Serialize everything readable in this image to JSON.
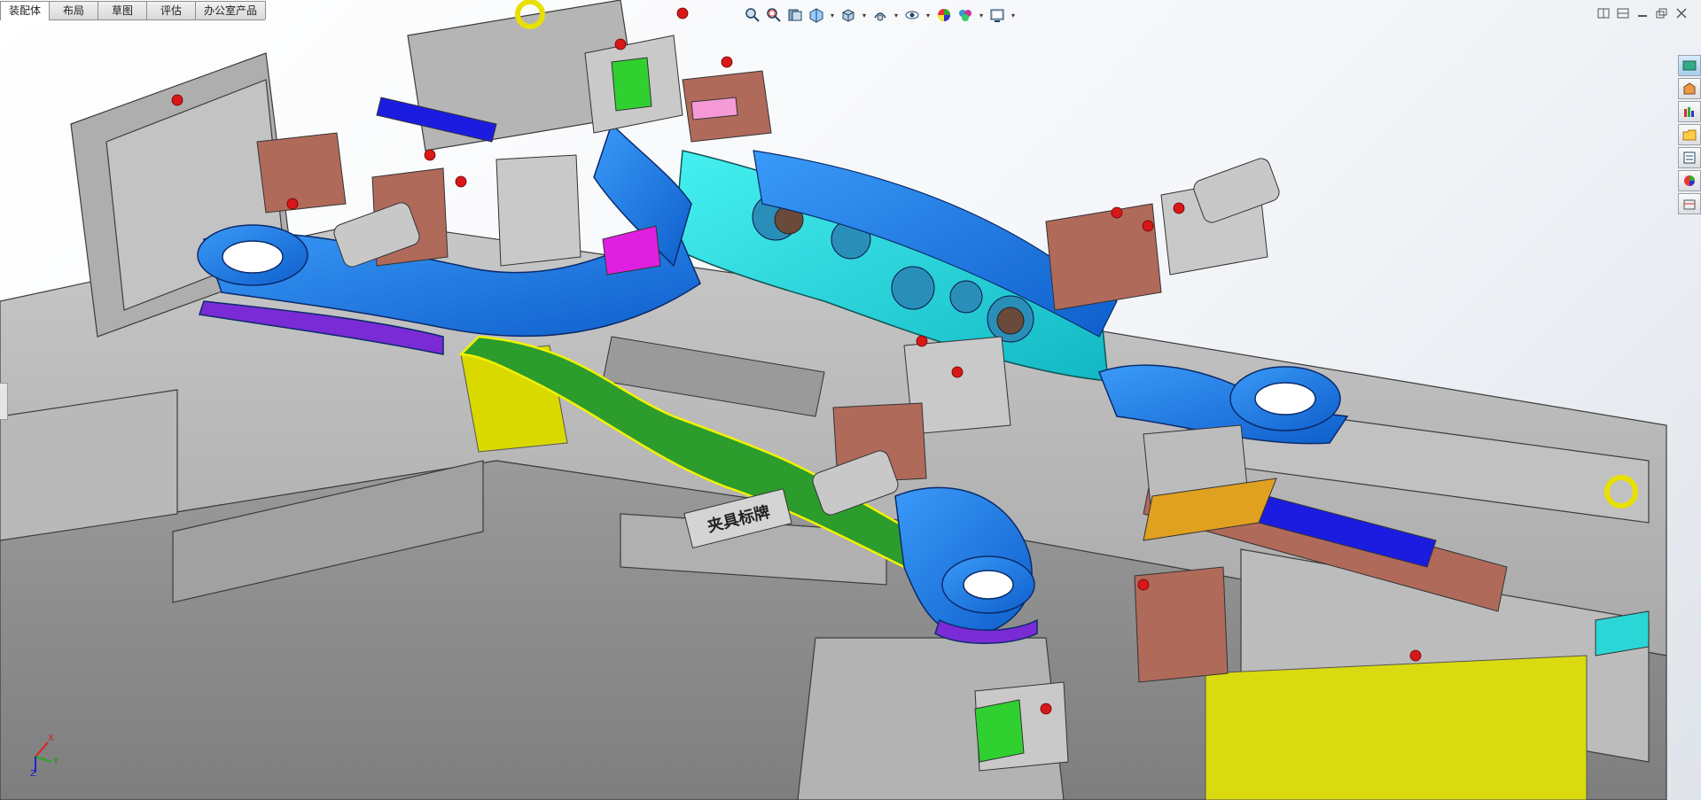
{
  "tabs": [
    {
      "label": "装配体",
      "active": true
    },
    {
      "label": "布局",
      "active": false
    },
    {
      "label": "草图",
      "active": false
    },
    {
      "label": "评估",
      "active": false
    },
    {
      "label": "办公室产品",
      "active": false
    }
  ],
  "plate_text": "夹具标牌",
  "triad": {
    "x": "X",
    "y": "Y",
    "z": "Z"
  },
  "view_toolbar": [
    "zoom-to-fit-icon",
    "zoom-area-icon",
    "previous-view-icon",
    "section-view-icon",
    "view-orientation-icon",
    "display-style-icon",
    "hide-show-items-icon",
    "edit-appearance-icon",
    "apply-scene-icon",
    "view-settings-icon"
  ],
  "taskpane": [
    "resources-icon",
    "design-library-icon",
    "file-explorer-icon",
    "view-palette-icon",
    "appearances-icon",
    "custom-properties-icon",
    "toolbox-icon"
  ],
  "colors": {
    "frame": "#b4b4b4",
    "blue_part": "#1f78e8",
    "purple_part": "#7a2bd6",
    "cyan_part": "#1fd8d8",
    "green_part": "#2aa02a",
    "yellow_edge": "#f2f200",
    "copper": "#b06a5a",
    "red_bolt": "#d81818"
  }
}
